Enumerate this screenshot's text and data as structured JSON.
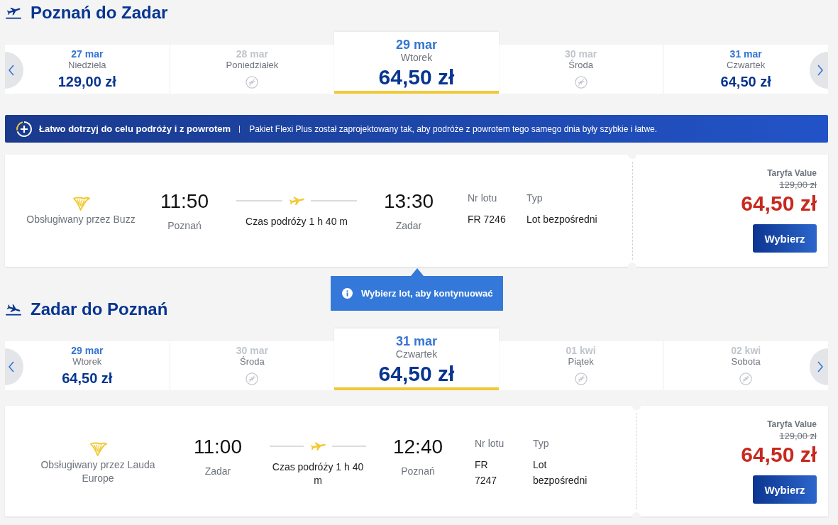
{
  "journeys": [
    {
      "kind": "departure",
      "title": "Poznań do Zadar",
      "dates": [
        {
          "date": "27 mar",
          "day": "Niedziela",
          "price": "129,00 zł",
          "available": true,
          "selected": false
        },
        {
          "date": "28 mar",
          "day": "Poniedziałek",
          "available": false,
          "selected": false
        },
        {
          "date": "29 mar",
          "day": "Wtorek",
          "price": "64,50 zł",
          "available": true,
          "selected": true
        },
        {
          "date": "30 mar",
          "day": "Środa",
          "available": false,
          "selected": false
        },
        {
          "date": "31 mar",
          "day": "Czwartek",
          "price": "64,50 zł",
          "available": true,
          "selected": false
        }
      ],
      "banner": {
        "title": "Łatwo dotrzyj do celu podróży i z powrotem",
        "text": "Pakiet Flexi Plus został zaprojektowany tak, aby podróże z powrotem tego samego dnia były szybkie i łatwe."
      },
      "flights": [
        {
          "operator": "Obsługiwany przez Buzz",
          "departure_time": "11:50",
          "departure_city": "Poznań",
          "duration": "Czas podróży 1 h 40 m",
          "arrival_time": "13:30",
          "arrival_city": "Zadar",
          "flight_number_label": "Nr lotu",
          "flight_number": "FR 7246",
          "type_label": "Typ",
          "type": "Lot bezpośredni",
          "fare_name": "Taryfa Value",
          "old_price": "129,00 zł",
          "price": "64,50 zł",
          "button": "Wybierz"
        }
      ],
      "tooltip": "Wybierz lot, aby kontynuować"
    },
    {
      "kind": "arrival",
      "title": "Zadar do Poznań",
      "dates": [
        {
          "date": "29 mar",
          "day": "Wtorek",
          "price": "64,50 zł",
          "available": true,
          "selected": false
        },
        {
          "date": "30 mar",
          "day": "Środa",
          "available": false,
          "selected": false
        },
        {
          "date": "31 mar",
          "day": "Czwartek",
          "price": "64,50 zł",
          "available": true,
          "selected": true
        },
        {
          "date": "01 kwi",
          "day": "Piątek",
          "available": false,
          "selected": false
        },
        {
          "date": "02 kwi",
          "day": "Sobota",
          "available": false,
          "selected": false
        }
      ],
      "flights": [
        {
          "operator": "Obsługiwany przez Lauda Europe",
          "departure_time": "11:00",
          "departure_city": "Zadar",
          "duration": "Czas podróży 1 h 40 m",
          "arrival_time": "12:40",
          "arrival_city": "Poznań",
          "flight_number_label": "Nr lotu",
          "flight_number": "FR 7247",
          "type_label": "Typ",
          "type": "Lot bezpośredni",
          "fare_name": "Taryfa Value",
          "old_price": "129,00 zł",
          "price": "64,50 zł",
          "button": "Wybierz"
        }
      ]
    }
  ]
}
